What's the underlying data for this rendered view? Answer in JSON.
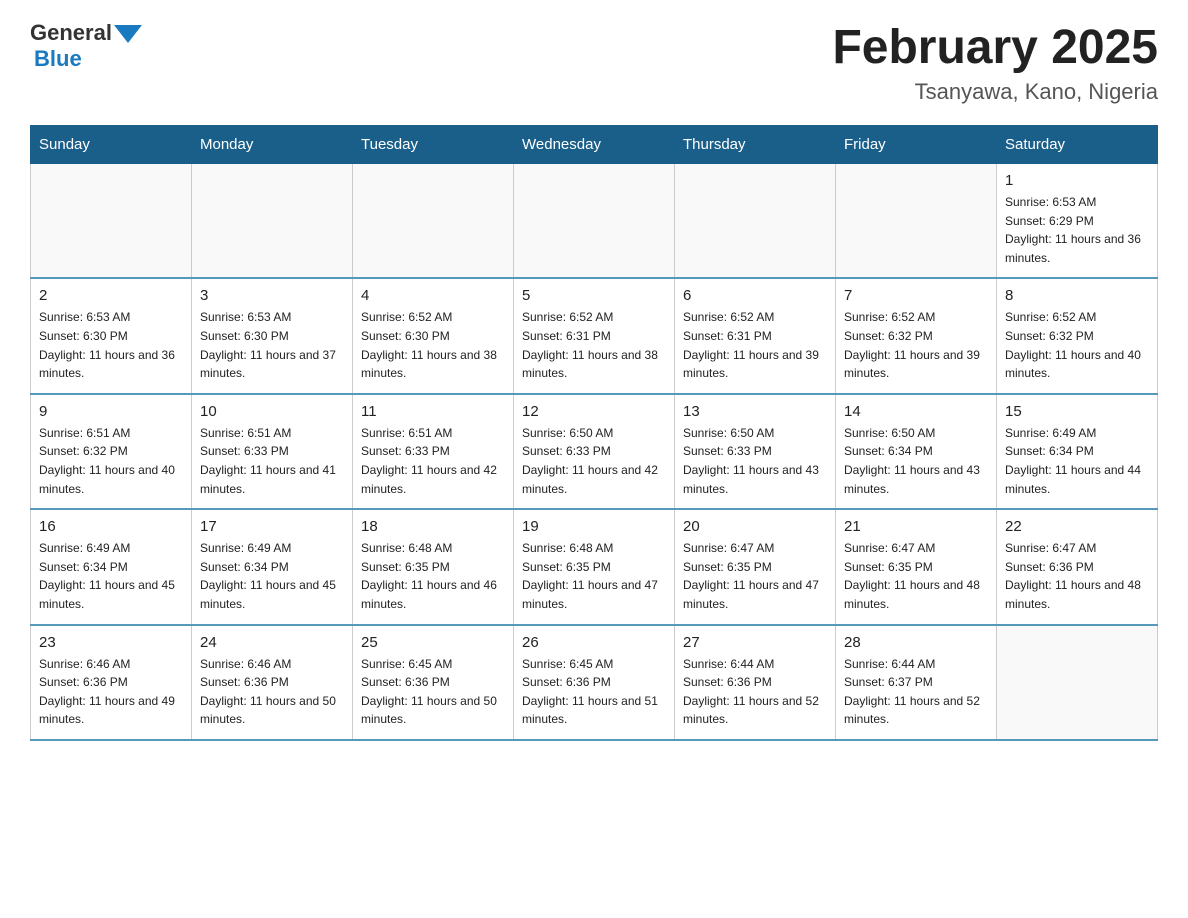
{
  "header": {
    "title": "February 2025",
    "subtitle": "Tsanyawa, Kano, Nigeria"
  },
  "logo": {
    "line1": "General",
    "line2": "Blue"
  },
  "days_of_week": [
    "Sunday",
    "Monday",
    "Tuesday",
    "Wednesday",
    "Thursday",
    "Friday",
    "Saturday"
  ],
  "weeks": [
    [
      {
        "day": "",
        "sunrise": "",
        "sunset": "",
        "daylight": ""
      },
      {
        "day": "",
        "sunrise": "",
        "sunset": "",
        "daylight": ""
      },
      {
        "day": "",
        "sunrise": "",
        "sunset": "",
        "daylight": ""
      },
      {
        "day": "",
        "sunrise": "",
        "sunset": "",
        "daylight": ""
      },
      {
        "day": "",
        "sunrise": "",
        "sunset": "",
        "daylight": ""
      },
      {
        "day": "",
        "sunrise": "",
        "sunset": "",
        "daylight": ""
      },
      {
        "day": "1",
        "sunrise": "Sunrise: 6:53 AM",
        "sunset": "Sunset: 6:29 PM",
        "daylight": "Daylight: 11 hours and 36 minutes."
      }
    ],
    [
      {
        "day": "2",
        "sunrise": "Sunrise: 6:53 AM",
        "sunset": "Sunset: 6:30 PM",
        "daylight": "Daylight: 11 hours and 36 minutes."
      },
      {
        "day": "3",
        "sunrise": "Sunrise: 6:53 AM",
        "sunset": "Sunset: 6:30 PM",
        "daylight": "Daylight: 11 hours and 37 minutes."
      },
      {
        "day": "4",
        "sunrise": "Sunrise: 6:52 AM",
        "sunset": "Sunset: 6:30 PM",
        "daylight": "Daylight: 11 hours and 38 minutes."
      },
      {
        "day": "5",
        "sunrise": "Sunrise: 6:52 AM",
        "sunset": "Sunset: 6:31 PM",
        "daylight": "Daylight: 11 hours and 38 minutes."
      },
      {
        "day": "6",
        "sunrise": "Sunrise: 6:52 AM",
        "sunset": "Sunset: 6:31 PM",
        "daylight": "Daylight: 11 hours and 39 minutes."
      },
      {
        "day": "7",
        "sunrise": "Sunrise: 6:52 AM",
        "sunset": "Sunset: 6:32 PM",
        "daylight": "Daylight: 11 hours and 39 minutes."
      },
      {
        "day": "8",
        "sunrise": "Sunrise: 6:52 AM",
        "sunset": "Sunset: 6:32 PM",
        "daylight": "Daylight: 11 hours and 40 minutes."
      }
    ],
    [
      {
        "day": "9",
        "sunrise": "Sunrise: 6:51 AM",
        "sunset": "Sunset: 6:32 PM",
        "daylight": "Daylight: 11 hours and 40 minutes."
      },
      {
        "day": "10",
        "sunrise": "Sunrise: 6:51 AM",
        "sunset": "Sunset: 6:33 PM",
        "daylight": "Daylight: 11 hours and 41 minutes."
      },
      {
        "day": "11",
        "sunrise": "Sunrise: 6:51 AM",
        "sunset": "Sunset: 6:33 PM",
        "daylight": "Daylight: 11 hours and 42 minutes."
      },
      {
        "day": "12",
        "sunrise": "Sunrise: 6:50 AM",
        "sunset": "Sunset: 6:33 PM",
        "daylight": "Daylight: 11 hours and 42 minutes."
      },
      {
        "day": "13",
        "sunrise": "Sunrise: 6:50 AM",
        "sunset": "Sunset: 6:33 PM",
        "daylight": "Daylight: 11 hours and 43 minutes."
      },
      {
        "day": "14",
        "sunrise": "Sunrise: 6:50 AM",
        "sunset": "Sunset: 6:34 PM",
        "daylight": "Daylight: 11 hours and 43 minutes."
      },
      {
        "day": "15",
        "sunrise": "Sunrise: 6:49 AM",
        "sunset": "Sunset: 6:34 PM",
        "daylight": "Daylight: 11 hours and 44 minutes."
      }
    ],
    [
      {
        "day": "16",
        "sunrise": "Sunrise: 6:49 AM",
        "sunset": "Sunset: 6:34 PM",
        "daylight": "Daylight: 11 hours and 45 minutes."
      },
      {
        "day": "17",
        "sunrise": "Sunrise: 6:49 AM",
        "sunset": "Sunset: 6:34 PM",
        "daylight": "Daylight: 11 hours and 45 minutes."
      },
      {
        "day": "18",
        "sunrise": "Sunrise: 6:48 AM",
        "sunset": "Sunset: 6:35 PM",
        "daylight": "Daylight: 11 hours and 46 minutes."
      },
      {
        "day": "19",
        "sunrise": "Sunrise: 6:48 AM",
        "sunset": "Sunset: 6:35 PM",
        "daylight": "Daylight: 11 hours and 47 minutes."
      },
      {
        "day": "20",
        "sunrise": "Sunrise: 6:47 AM",
        "sunset": "Sunset: 6:35 PM",
        "daylight": "Daylight: 11 hours and 47 minutes."
      },
      {
        "day": "21",
        "sunrise": "Sunrise: 6:47 AM",
        "sunset": "Sunset: 6:35 PM",
        "daylight": "Daylight: 11 hours and 48 minutes."
      },
      {
        "day": "22",
        "sunrise": "Sunrise: 6:47 AM",
        "sunset": "Sunset: 6:36 PM",
        "daylight": "Daylight: 11 hours and 48 minutes."
      }
    ],
    [
      {
        "day": "23",
        "sunrise": "Sunrise: 6:46 AM",
        "sunset": "Sunset: 6:36 PM",
        "daylight": "Daylight: 11 hours and 49 minutes."
      },
      {
        "day": "24",
        "sunrise": "Sunrise: 6:46 AM",
        "sunset": "Sunset: 6:36 PM",
        "daylight": "Daylight: 11 hours and 50 minutes."
      },
      {
        "day": "25",
        "sunrise": "Sunrise: 6:45 AM",
        "sunset": "Sunset: 6:36 PM",
        "daylight": "Daylight: 11 hours and 50 minutes."
      },
      {
        "day": "26",
        "sunrise": "Sunrise: 6:45 AM",
        "sunset": "Sunset: 6:36 PM",
        "daylight": "Daylight: 11 hours and 51 minutes."
      },
      {
        "day": "27",
        "sunrise": "Sunrise: 6:44 AM",
        "sunset": "Sunset: 6:36 PM",
        "daylight": "Daylight: 11 hours and 52 minutes."
      },
      {
        "day": "28",
        "sunrise": "Sunrise: 6:44 AM",
        "sunset": "Sunset: 6:37 PM",
        "daylight": "Daylight: 11 hours and 52 minutes."
      },
      {
        "day": "",
        "sunrise": "",
        "sunset": "",
        "daylight": ""
      }
    ]
  ]
}
